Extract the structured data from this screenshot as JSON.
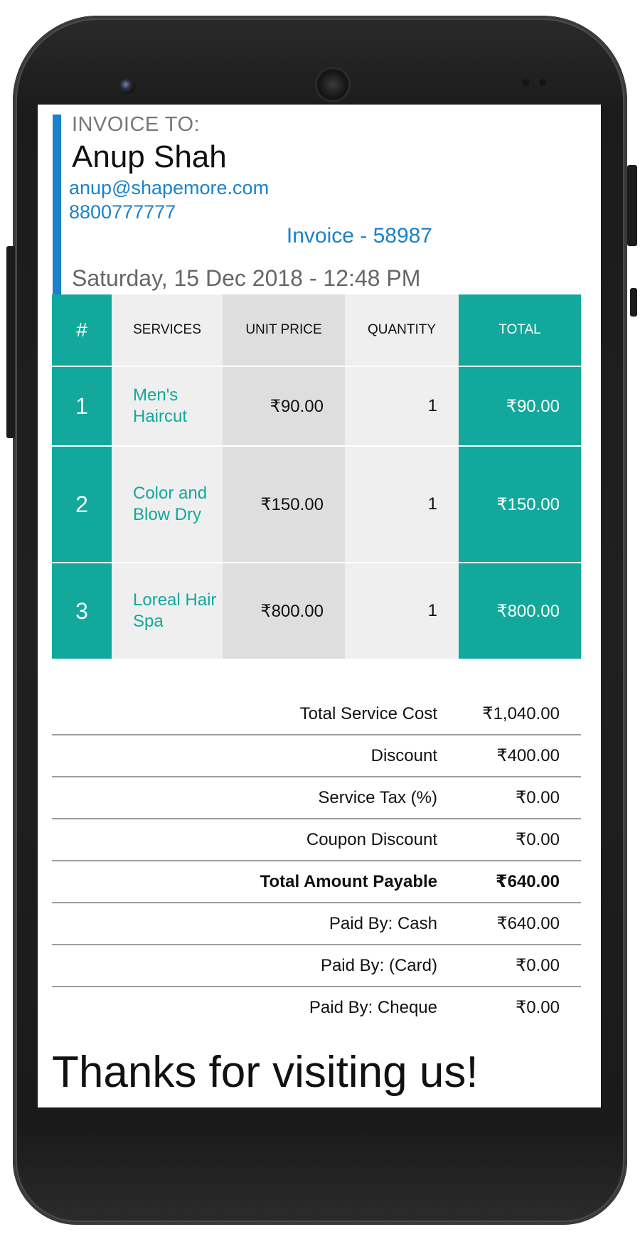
{
  "invoice": {
    "to_label": "INVOICE TO:",
    "customer_name": "Anup Shah",
    "email": "anup@shapemore.com",
    "phone": "8800777777",
    "number": "Invoice - 58987",
    "date": "Saturday, 15 Dec 2018 - 12:48 PM"
  },
  "table": {
    "headers": {
      "num": "#",
      "services": "SERVICES",
      "unit_price": "UNIT PRICE",
      "quantity": "QUANTITY",
      "total": "TOTAL"
    },
    "rows": [
      {
        "num": "1",
        "service": "Men's Haircut",
        "unit_price": "₹90.00",
        "quantity": "1",
        "total": "₹90.00"
      },
      {
        "num": "2",
        "service": "Color and Blow Dry",
        "unit_price": "₹150.00",
        "quantity": "1",
        "total": "₹150.00"
      },
      {
        "num": "3",
        "service": "Loreal Hair Spa",
        "unit_price": "₹800.00",
        "quantity": "1",
        "total": "₹800.00"
      }
    ]
  },
  "summary": [
    {
      "label": "Total Service Cost",
      "value": "₹1,040.00"
    },
    {
      "label": "Discount",
      "value": "₹400.00"
    },
    {
      "label": "Service Tax (%)",
      "value": "₹0.00"
    },
    {
      "label": "Coupon Discount",
      "value": "₹0.00"
    },
    {
      "label": "Total Amount Payable",
      "value": "₹640.00"
    },
    {
      "label": "Paid By: Cash",
      "value": "₹640.00"
    },
    {
      "label": "Paid By: (Card)",
      "value": "₹0.00"
    },
    {
      "label": "Paid By: Cheque",
      "value": "₹0.00"
    }
  ],
  "footer": {
    "thanks": "Thanks for visiting us!"
  },
  "colors": {
    "accent_blue": "#1a82c8",
    "teal": "#12a89b",
    "cell_light": "#efefef",
    "cell_mid": "#dedede"
  }
}
